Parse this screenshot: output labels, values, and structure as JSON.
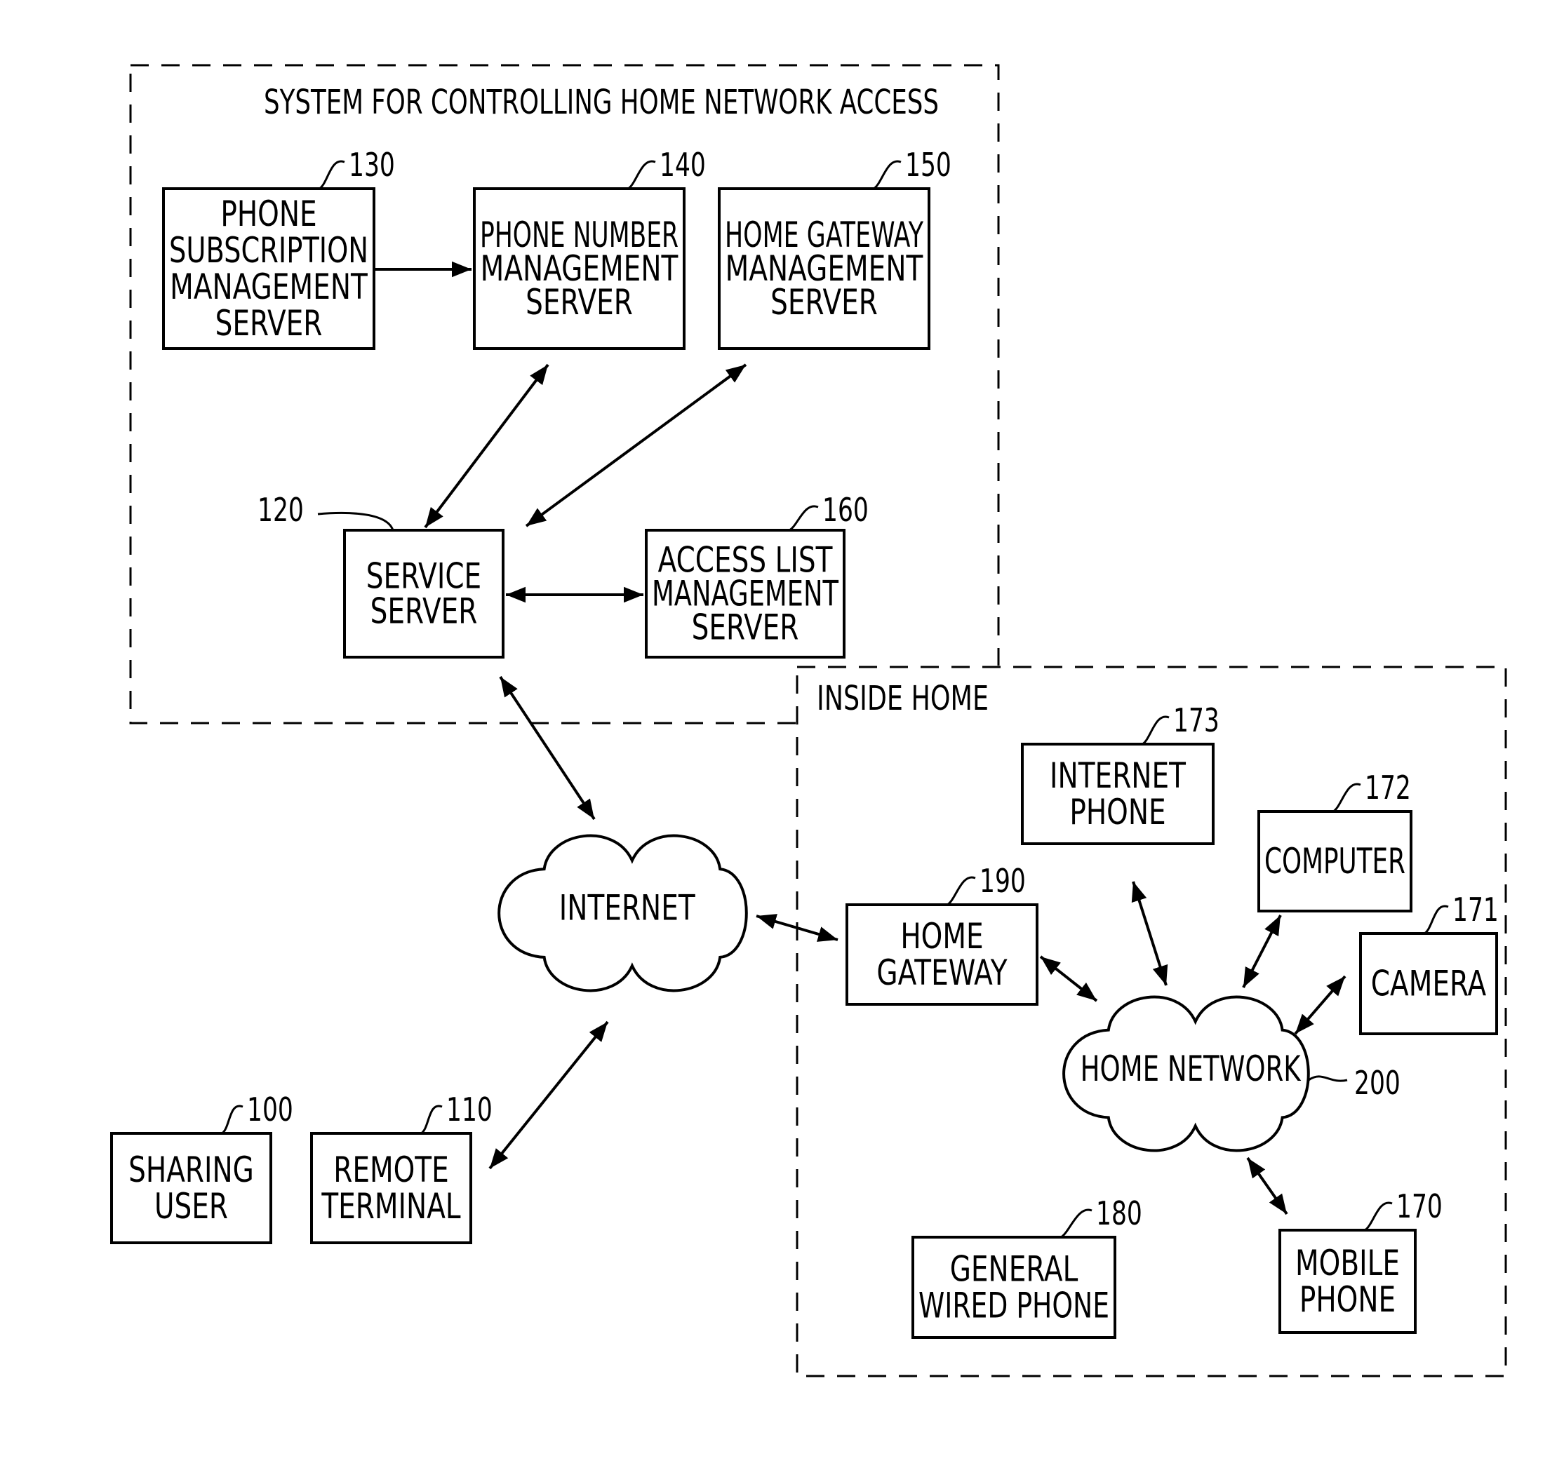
{
  "regions": {
    "system": {
      "title": "SYSTEM FOR CONTROLLING HOME NETWORK ACCESS"
    },
    "home": {
      "title": "INSIDE HOME"
    }
  },
  "nodes": {
    "phone_subscription": {
      "ref": "130",
      "lines": [
        "PHONE",
        "SUBSCRIPTION",
        "MANAGEMENT",
        "SERVER"
      ]
    },
    "phone_number": {
      "ref": "140",
      "lines": [
        "PHONE NUMBER",
        "MANAGEMENT",
        "SERVER"
      ]
    },
    "home_gateway_mgmt": {
      "ref": "150",
      "lines": [
        "HOME GATEWAY",
        "MANAGEMENT",
        "SERVER"
      ]
    },
    "service_server": {
      "ref": "120",
      "lines": [
        "SERVICE",
        "SERVER"
      ]
    },
    "access_list": {
      "ref": "160",
      "lines": [
        "ACCESS LIST",
        "MANAGEMENT",
        "SERVER"
      ]
    },
    "internet": {
      "lines": [
        "INTERNET"
      ]
    },
    "sharing_user": {
      "ref": "100",
      "lines": [
        "SHARING",
        "USER"
      ]
    },
    "remote_terminal": {
      "ref": "110",
      "lines": [
        "REMOTE",
        "TERMINAL"
      ]
    },
    "home_gateway": {
      "ref": "190",
      "lines": [
        "HOME",
        "GATEWAY"
      ]
    },
    "internet_phone": {
      "ref": "173",
      "lines": [
        "INTERNET",
        "PHONE"
      ]
    },
    "computer": {
      "ref": "172",
      "lines": [
        "COMPUTER"
      ]
    },
    "camera": {
      "ref": "171",
      "lines": [
        "CAMERA"
      ]
    },
    "home_network": {
      "ref": "200",
      "lines": [
        "HOME NETWORK"
      ]
    },
    "general_wired_phone": {
      "ref": "180",
      "lines": [
        "GENERAL",
        "WIRED PHONE"
      ]
    },
    "mobile_phone": {
      "ref": "170",
      "lines": [
        "MOBILE",
        "PHONE"
      ]
    }
  },
  "connections": [
    {
      "from": "phone_subscription",
      "to": "phone_number",
      "direction": "one-way"
    },
    {
      "from": "phone_number",
      "to": "service_server",
      "direction": "two-way"
    },
    {
      "from": "home_gateway_mgmt",
      "to": "service_server",
      "direction": "two-way"
    },
    {
      "from": "service_server",
      "to": "access_list",
      "direction": "two-way"
    },
    {
      "from": "service_server",
      "to": "internet",
      "direction": "two-way"
    },
    {
      "from": "remote_terminal",
      "to": "internet",
      "direction": "two-way"
    },
    {
      "from": "internet",
      "to": "home_gateway",
      "direction": "two-way"
    },
    {
      "from": "home_gateway",
      "to": "home_network",
      "direction": "two-way"
    },
    {
      "from": "internet_phone",
      "to": "home_network",
      "direction": "two-way"
    },
    {
      "from": "computer",
      "to": "home_network",
      "direction": "two-way"
    },
    {
      "from": "camera",
      "to": "home_network",
      "direction": "two-way"
    },
    {
      "from": "mobile_phone",
      "to": "home_network",
      "direction": "two-way"
    }
  ]
}
